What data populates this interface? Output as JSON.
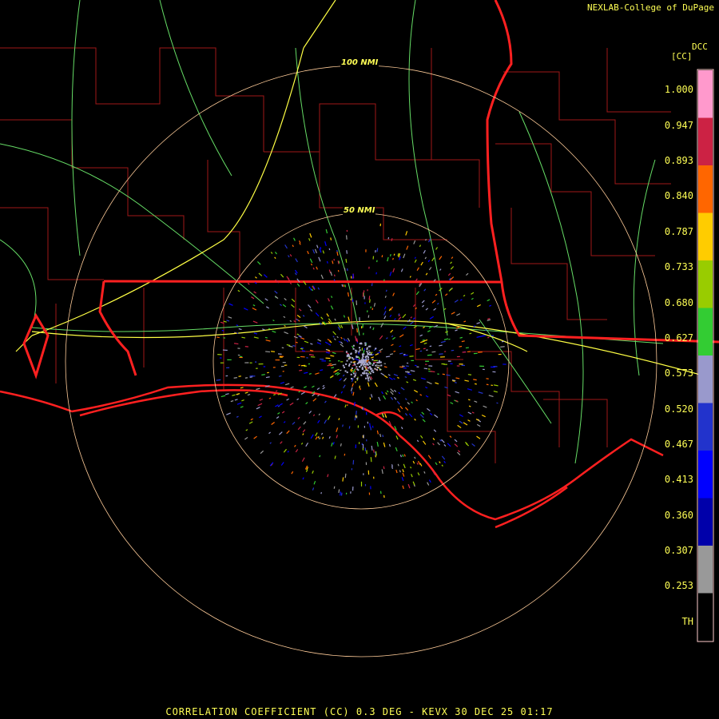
{
  "header": {
    "credit": "NEXLAB-College of DuPage",
    "product_code": "DCC",
    "unit": "[CC]"
  },
  "footer": {
    "title": "CORRELATION COEFFICIENT (CC) 0.3 DEG - KEVX 30 DEC 25 01:17"
  },
  "range_rings": [
    {
      "label": "100 NMI"
    },
    {
      "label": "50 NMI"
    }
  ],
  "legend": {
    "labels": [
      "1.000",
      "0.947",
      "0.893",
      "0.840",
      "0.787",
      "0.733",
      "0.680",
      "0.627",
      "0.573",
      "0.520",
      "0.467",
      "0.413",
      "0.360",
      "0.307",
      "0.253",
      "TH"
    ],
    "colors": [
      "#ff99cc",
      "#cc2244",
      "#ff6600",
      "#ffcc00",
      "#99cc00",
      "#33cc33",
      "#9999cc",
      "#2233cc",
      "#0000ff",
      "#0000aa",
      "#999999",
      "#000000"
    ]
  },
  "colors": {
    "state_border": "#ff2020",
    "county_border": "#a01818",
    "highway": "#ffff44",
    "road": "#66dd66",
    "ring": "#ffcc99",
    "coast": "#ff2020"
  }
}
